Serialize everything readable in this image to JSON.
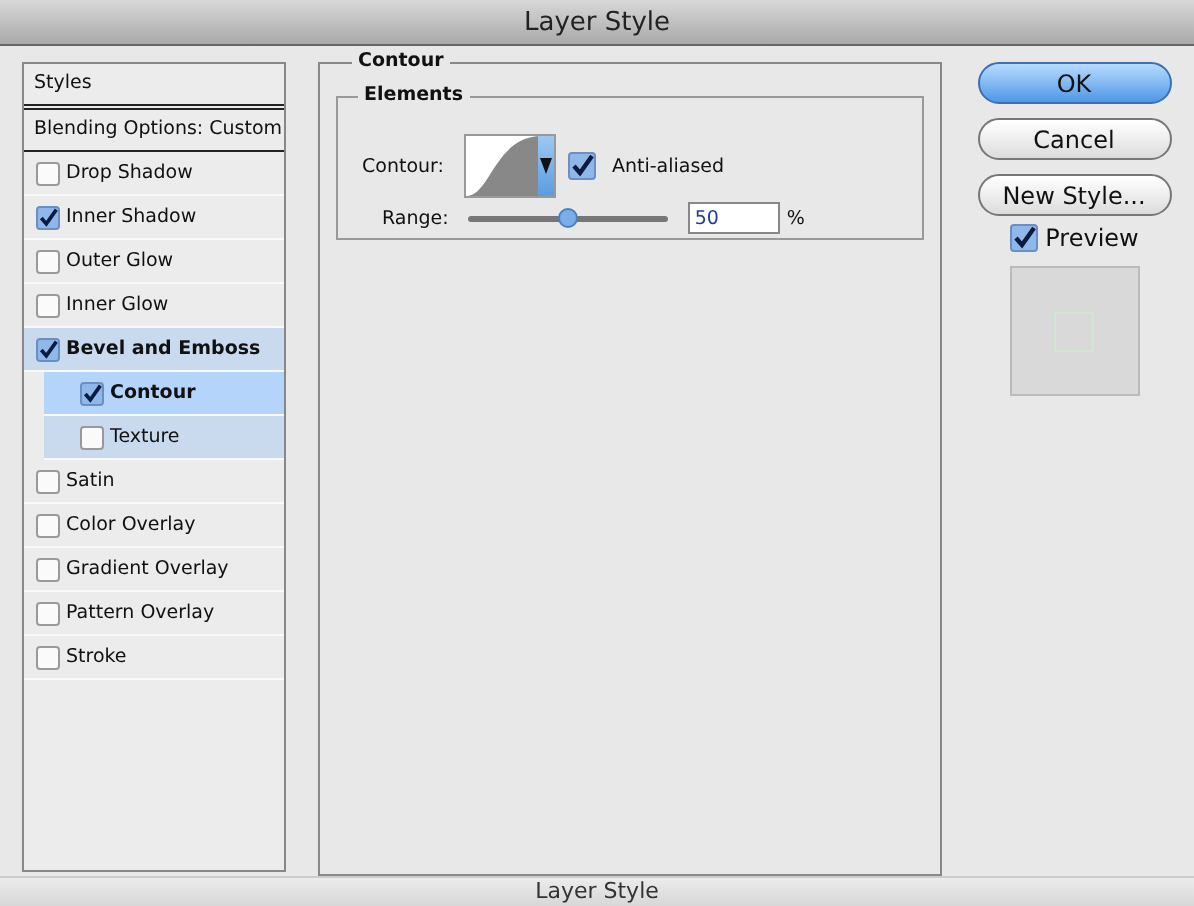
{
  "window": {
    "title": "Layer Style"
  },
  "sidebar": {
    "header": "Styles",
    "blending": "Blending Options: Custom",
    "items": [
      {
        "label": "Drop Shadow",
        "checked": false,
        "selected": false
      },
      {
        "label": "Inner Shadow",
        "checked": true,
        "selected": false
      },
      {
        "label": "Outer Glow",
        "checked": false,
        "selected": false
      },
      {
        "label": "Inner Glow",
        "checked": false,
        "selected": false
      },
      {
        "label": "Bevel and Emboss",
        "checked": true,
        "selected": false,
        "expanded": true,
        "children": [
          {
            "label": "Contour",
            "checked": true,
            "selected": true
          },
          {
            "label": "Texture",
            "checked": false,
            "selected": false
          }
        ]
      },
      {
        "label": "Satin",
        "checked": false,
        "selected": false
      },
      {
        "label": "Color Overlay",
        "checked": false,
        "selected": false
      },
      {
        "label": "Gradient Overlay",
        "checked": false,
        "selected": false
      },
      {
        "label": "Pattern Overlay",
        "checked": false,
        "selected": false
      },
      {
        "label": "Stroke",
        "checked": false,
        "selected": false
      }
    ]
  },
  "panel": {
    "title": "Contour",
    "group": "Elements",
    "contour_label": "Contour:",
    "anti_aliased": {
      "label": "Anti-aliased",
      "checked": true
    },
    "range": {
      "label": "Range:",
      "level": 0.5,
      "value": "50",
      "unit": "%"
    }
  },
  "buttons": [
    {
      "label": "OK",
      "default": true
    },
    {
      "label": "Cancel",
      "default": false
    },
    {
      "label": "New Style...",
      "default": false
    }
  ],
  "preview": {
    "label": "Preview",
    "checked": true
  },
  "bottom_window": {
    "title": "Layer Style"
  }
}
